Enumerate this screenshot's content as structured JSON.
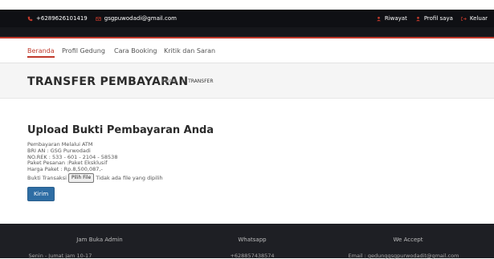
{
  "topbar": {
    "phone": "+6289626101419",
    "email": "gsgpuwodadi@gmail.com",
    "links": [
      "Riwayat",
      "Profil saya",
      "Keluar"
    ]
  },
  "nav": {
    "items": [
      "Beranda",
      "Profil Gedung",
      "Cara Booking",
      "Kritik dan Saran"
    ],
    "active": "Beranda"
  },
  "hero": {
    "title": "TRANSFER PEMBAYARAN",
    "breadcrumb_home": "HOME",
    "breadcrumb_sep": "/",
    "breadcrumb_current": "TRANSFER"
  },
  "upload": {
    "heading": "Upload Bukti Pembayaran Anda",
    "lines": [
      "Pembayaran Melalui ATM",
      "BRI AN : GSG Purwodadi",
      "NO.REK : 533 - 601 - 2104 - 58538",
      "Paket Pesanan :Paket Eksklusif",
      "Harga Paket   : Rp.8,500,087,-"
    ],
    "file_label": "Bukti Transaksi",
    "file_button": "Pilih File",
    "file_status": "Tidak ada file yang dipilih",
    "submit": "Kirim"
  },
  "footer": {
    "headings": [
      "Jam Buka Admin",
      "Whatsapp",
      "We Accept"
    ],
    "values": [
      "Senin - Jumat jam 10-17",
      "+628857438574",
      "Email : gedunggsgpurwodadit@gmail.com"
    ]
  },
  "colors": {
    "accent": "#c0392b",
    "button": "#2e6da4",
    "dark": "#0f1014"
  }
}
